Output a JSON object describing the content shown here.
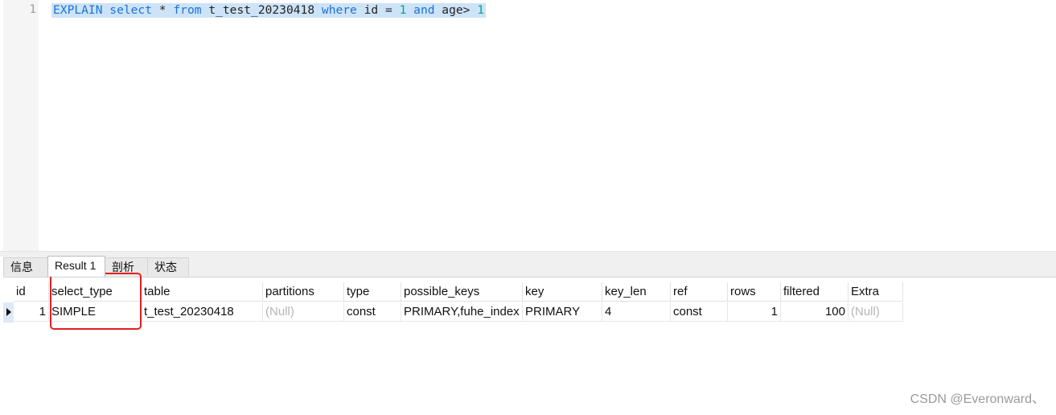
{
  "editor": {
    "line_number": "1",
    "tokens": {
      "t1": "EXPLAIN select",
      "t2": " * ",
      "t3": "from",
      "t4": " t_test_20230418 ",
      "t5": "where",
      "t6": " id = ",
      "t7": "1",
      "t8": " ",
      "t9": "and",
      "t10": " age> ",
      "t11": "1"
    }
  },
  "tabs": {
    "info": "信息",
    "result1": "Result 1",
    "profile": "剖析",
    "status": "状态"
  },
  "table": {
    "columns": [
      "id",
      "select_type",
      "table",
      "partitions",
      "type",
      "possible_keys",
      "key",
      "key_len",
      "ref",
      "rows",
      "filtered",
      "Extra"
    ],
    "rows": [
      [
        "1",
        "SIMPLE",
        "t_test_20230418",
        "(Null)",
        "const",
        "PRIMARY,fuhe_index",
        "PRIMARY",
        "4",
        "const",
        "1",
        "100",
        "(Null)"
      ]
    ]
  },
  "watermark": "CSDN @Everonward、",
  "colors": {
    "keyword": "#1a73d8",
    "number": "#0aa08c",
    "selection": "#cde3f7",
    "highlight_box": "#e22020",
    "null_text": "#b5b5b5"
  }
}
